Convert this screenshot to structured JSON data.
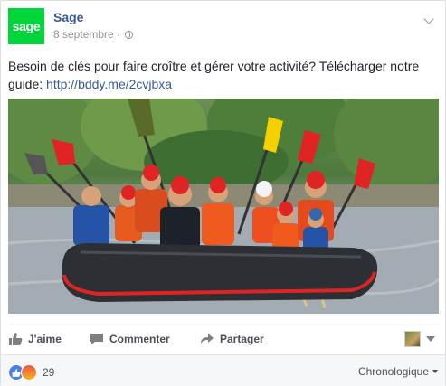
{
  "post": {
    "page_name": "Sage",
    "logo_text": "sage",
    "date": "8 septembre",
    "separator": "·",
    "text": "Besoin de clés pour faire croître et gérer votre activité? Télécharger notre guide: ",
    "link": "http://bddy.me/2cvjbxa",
    "brand_color": "#00d639"
  },
  "actions": {
    "like": "J'aime",
    "comment": "Commenter",
    "share": "Partager"
  },
  "footer": {
    "reaction_count": "29",
    "sort_label": "Chronologique"
  },
  "icons": [
    "globe-icon",
    "chevron-down-icon",
    "thumbs-up-icon",
    "comment-icon",
    "share-arrow-icon",
    "like-reaction-icon",
    "angry-reaction-icon"
  ]
}
